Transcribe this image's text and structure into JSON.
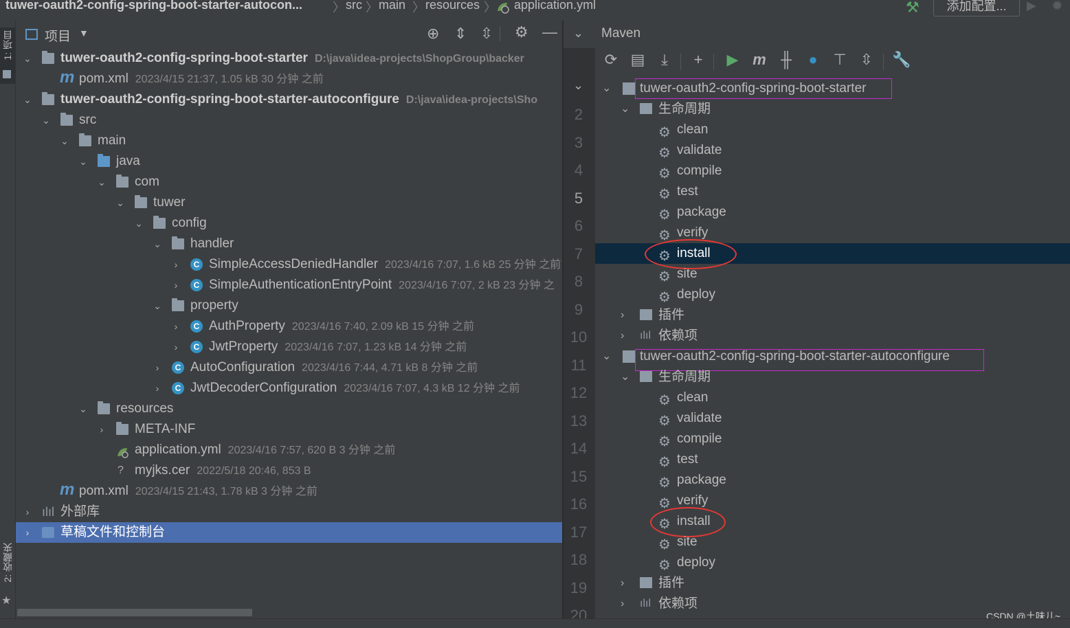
{
  "breadcrumb": {
    "project": "tuwer-oauth2-config-spring-boot-starter-autocon...",
    "items": [
      "src",
      "main",
      "resources",
      "application.yml"
    ],
    "add_config": "添加配置..."
  },
  "left_strip": {
    "tab_project": "1: 项目",
    "tab_favorites": "2: 收藏夹"
  },
  "project_panel": {
    "title": "项目",
    "rows": [
      {
        "label": "tuwer-oauth2-config-spring-boot-starter",
        "meta": "D:\\java\\idea-projects\\ShopGroup\\backer"
      },
      {
        "label": "pom.xml",
        "meta": "2023/4/15 21:37, 1.05 kB 30 分钟 之前"
      },
      {
        "label": "tuwer-oauth2-config-spring-boot-starter-autoconfigure",
        "meta": "D:\\java\\idea-projects\\Sho"
      },
      {
        "label": "src",
        "meta": ""
      },
      {
        "label": "main",
        "meta": ""
      },
      {
        "label": "java",
        "meta": ""
      },
      {
        "label": "com",
        "meta": ""
      },
      {
        "label": "tuwer",
        "meta": ""
      },
      {
        "label": "config",
        "meta": ""
      },
      {
        "label": "handler",
        "meta": ""
      },
      {
        "label": "SimpleAccessDeniedHandler",
        "meta": "2023/4/16 7:07, 1.6 kB 25 分钟 之前"
      },
      {
        "label": "SimpleAuthenticationEntryPoint",
        "meta": "2023/4/16 7:07, 2 kB 23 分钟 之"
      },
      {
        "label": "property",
        "meta": ""
      },
      {
        "label": "AuthProperty",
        "meta": "2023/4/16 7:40, 2.09 kB 15 分钟 之前"
      },
      {
        "label": "JwtProperty",
        "meta": "2023/4/16 7:07, 1.23 kB 14 分钟 之前"
      },
      {
        "label": "AutoConfiguration",
        "meta": "2023/4/16 7:44, 4.71 kB 8 分钟 之前"
      },
      {
        "label": "JwtDecoderConfiguration",
        "meta": "2023/4/16 7:07, 4.3 kB 12 分钟 之前"
      },
      {
        "label": "resources",
        "meta": ""
      },
      {
        "label": "META-INF",
        "meta": ""
      },
      {
        "label": "application.yml",
        "meta": "2023/4/16 7:57, 620 B 3 分钟 之前"
      },
      {
        "label": "myjks.cer",
        "meta": "2022/5/18 20:46, 853 B"
      },
      {
        "label": "pom.xml",
        "meta": "2023/4/15 21:43, 1.78 kB 3 分钟 之前"
      },
      {
        "label": "外部库",
        "meta": ""
      },
      {
        "label": "草稿文件和控制台",
        "meta": ""
      }
    ]
  },
  "gutter": {
    "lines": [
      "2",
      "3",
      "4",
      "5",
      "6",
      "7",
      "8",
      "9",
      "10",
      "11",
      "12",
      "13",
      "14",
      "15",
      "16",
      "17",
      "18",
      "19",
      "20"
    ]
  },
  "maven": {
    "title": "Maven",
    "projects": [
      {
        "name": "tuwer-oauth2-config-spring-boot-starter",
        "lifecycle_label": "生命周期",
        "goals": [
          "clean",
          "validate",
          "compile",
          "test",
          "package",
          "verify",
          "install",
          "site",
          "deploy"
        ],
        "plugins_label": "插件",
        "deps_label": "依赖项"
      },
      {
        "name": "tuwer-oauth2-config-spring-boot-starter-autoconfigure",
        "lifecycle_label": "生命周期",
        "goals": [
          "clean",
          "validate",
          "compile",
          "test",
          "package",
          "verify",
          "install",
          "site",
          "deploy"
        ],
        "plugins_label": "插件",
        "deps_label": "依赖项"
      }
    ]
  },
  "watermark": "CSDN @土味儿~",
  "colors": {
    "selection": "#4b6eaf",
    "maven_selection": "#0d293e",
    "highlight_box": "#c42bd2",
    "circle": "#e53935"
  }
}
